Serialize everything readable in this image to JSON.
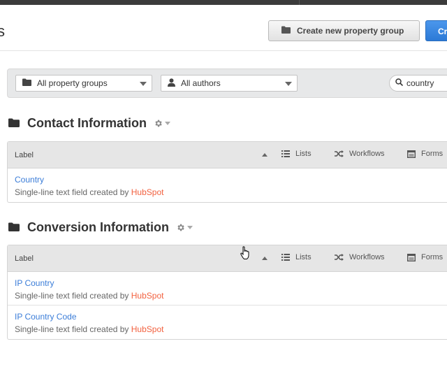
{
  "header": {
    "title_fragment": "s",
    "create_group_label": "Create new property group",
    "create_property_label": "Cr"
  },
  "filters": {
    "groups_label": "All property groups",
    "authors_label": "All authors",
    "search_value": "country"
  },
  "sections": [
    {
      "title": "Contact Information",
      "columns": {
        "label": "Label",
        "lists": "Lists",
        "workflows": "Workflows",
        "forms": "Forms"
      },
      "rows": [
        {
          "name": "Country",
          "desc_prefix": "Single-line text field created by ",
          "author": "HubSpot"
        }
      ]
    },
    {
      "title": "Conversion Information",
      "columns": {
        "label": "Label",
        "lists": "Lists",
        "workflows": "Workflows",
        "forms": "Forms"
      },
      "rows": [
        {
          "name": "IP Country",
          "desc_prefix": "Single-line text field created by ",
          "author": "HubSpot"
        },
        {
          "name": "IP Country Code",
          "desc_prefix": "Single-line text field created by ",
          "author": "HubSpot"
        }
      ]
    }
  ],
  "icons": {
    "folder": "folder-icon",
    "person": "person-icon",
    "search": "search-icon",
    "gear": "gear-icon",
    "lists": "lists-icon",
    "workflows": "shuffle-icon",
    "forms": "form-icon",
    "cursor": "hand-cursor-icon"
  },
  "colors": {
    "link": "#3b7dd8",
    "author": "#f2613f",
    "primary_button": "#2c79d6"
  }
}
